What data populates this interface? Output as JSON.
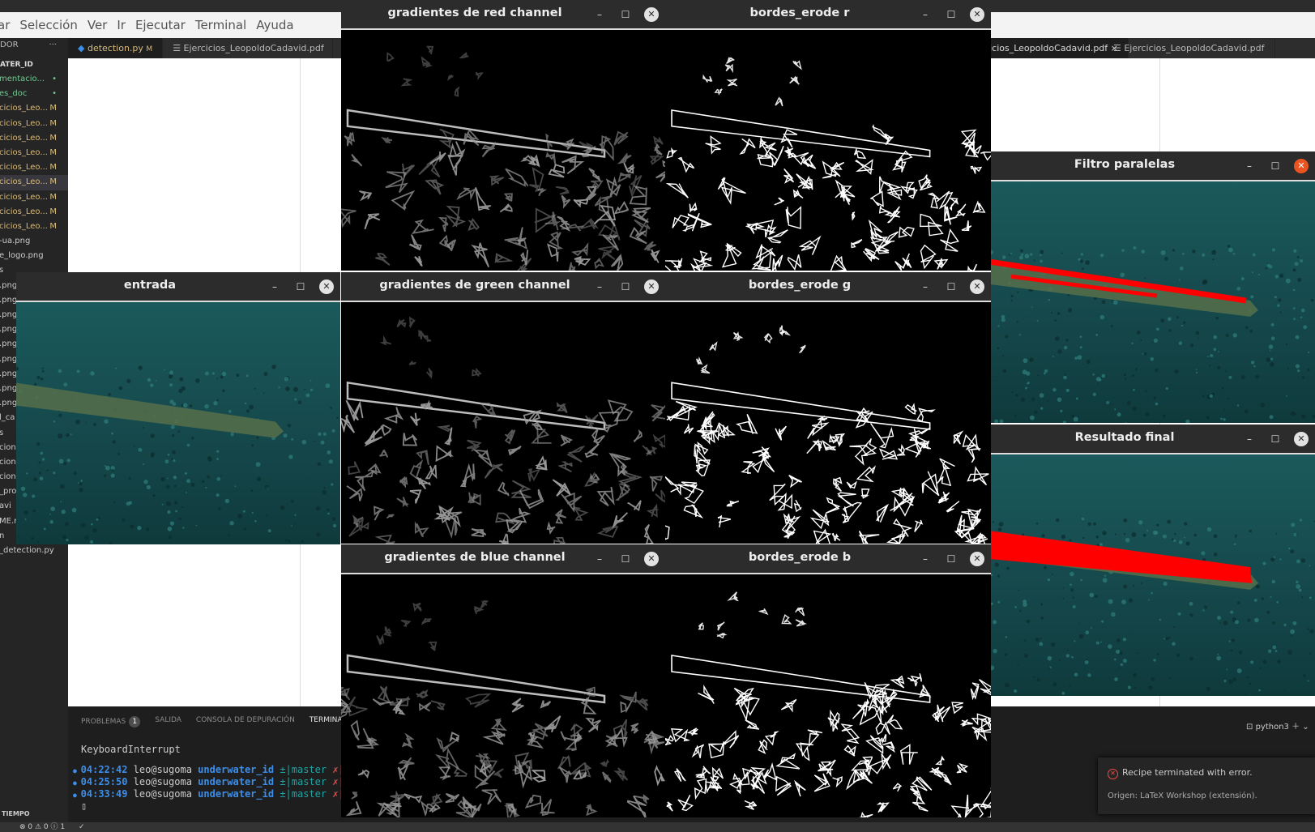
{
  "menubar": {
    "items": [
      "ar",
      "Selección",
      "Ver",
      "Ir",
      "Ejecutar",
      "Terminal",
      "Ayuda"
    ]
  },
  "sidebar": {
    "header": "DOR",
    "more": "···",
    "root": "ATER_ID",
    "files": [
      {
        "name": "mentacio...",
        "badge": "•",
        "style": "folder"
      },
      {
        "name": "es_doc",
        "badge": "•",
        "style": "folder"
      },
      {
        "name": "cicios_Leo...",
        "badge": "M",
        "style": "modified"
      },
      {
        "name": "cicios_Leo...",
        "badge": "M",
        "style": "modified"
      },
      {
        "name": "cicios_Leo...",
        "badge": "M",
        "style": "modified"
      },
      {
        "name": "cicios_Leo...",
        "badge": "M",
        "style": "modified"
      },
      {
        "name": "cicios_Leo...",
        "badge": "M",
        "style": "modified"
      },
      {
        "name": "cicios_Leo...",
        "badge": "M",
        "style": "selected"
      },
      {
        "name": "cicios_Leo...",
        "badge": "M",
        "style": "modified"
      },
      {
        "name": "cicios_Leo...",
        "badge": "M",
        "style": "modified"
      },
      {
        "name": "cicios_Leo...",
        "badge": "M",
        "style": "modified"
      },
      {
        "name": "-ua.png",
        "badge": "",
        "style": "plain"
      },
      {
        "name": "e_logo.png",
        "badge": "",
        "style": "plain"
      },
      {
        "name": "s",
        "badge": "",
        "style": "plain"
      },
      {
        "name": ".png",
        "badge": "",
        "style": "plain"
      },
      {
        "name": ".png",
        "badge": "",
        "style": "plain"
      },
      {
        "name": ".png",
        "badge": "",
        "style": "plain"
      },
      {
        "name": ".png",
        "badge": "",
        "style": "plain"
      },
      {
        "name": ".png",
        "badge": "",
        "style": "plain"
      },
      {
        "name": ".png",
        "badge": "",
        "style": "plain"
      },
      {
        "name": ".png",
        "badge": "",
        "style": "plain"
      },
      {
        "name": ".png",
        "badge": "",
        "style": "plain"
      },
      {
        "name": ".png",
        "badge": "",
        "style": "plain"
      },
      {
        "name": "l_ca",
        "badge": "",
        "style": "plain"
      },
      {
        "name": "s",
        "badge": "",
        "style": "plain"
      },
      {
        "name": "cion",
        "badge": "",
        "style": "plain"
      },
      {
        "name": "cion.",
        "badge": "",
        "style": "plain"
      },
      {
        "name": "cion",
        "badge": "",
        "style": "plain"
      },
      {
        "name": "_pro",
        "badge": "",
        "style": "plain"
      },
      {
        "name": "avi",
        "badge": "",
        "style": "plain"
      },
      {
        "name": "ME.r",
        "badge": "",
        "style": "plain"
      },
      {
        "name": "n",
        "badge": "",
        "style": "plain"
      },
      {
        "name": "_detection.py",
        "badge": "",
        "style": "plain"
      }
    ],
    "timeline": "TIEMPO"
  },
  "tabs": [
    {
      "label": "detection.py",
      "badge": "M",
      "icon": "python-file-icon",
      "active": true
    },
    {
      "label": "Ejercicios_LeopoldoCadavid.pdf",
      "badge": "",
      "icon": "pdf-file-icon",
      "active": false
    },
    {
      "label": "Ejercicios_LeopoldoCadavid.pdf",
      "badge": "×",
      "icon": "pdf-file-icon",
      "active": true
    },
    {
      "label": "Ejercicios_LeopoldoCadavid.pdf",
      "badge": "",
      "icon": "pdf-file-icon",
      "active": false
    }
  ],
  "panel": {
    "tabs": [
      "PROBLEMAS",
      "SALIDA",
      "CONSOLA DE DEPURACIÓN",
      "TERMINA"
    ],
    "problems_count": "1",
    "shell": "python3",
    "terminal": {
      "interrupt": "KeyboardInterrupt",
      "lines": [
        {
          "time": "04:22:42",
          "user": "leo@sugoma",
          "dir": "underwater_id",
          "branch": "±|master",
          "flag": "✗|"
        },
        {
          "time": "04:25:50",
          "user": "leo@sugoma",
          "dir": "underwater_id",
          "branch": "±|master",
          "flag": "✗|"
        },
        {
          "time": "04:33:49",
          "user": "leo@sugoma",
          "dir": "underwater_id",
          "branch": "±|master",
          "flag": "✗|"
        }
      ]
    }
  },
  "notification": {
    "message": "Recipe terminated with error.",
    "source": "Origen: LaTeX Workshop (extensión)."
  },
  "statusbar": {
    "errors": "⊗ 0 ⚠ 0 ⓘ 1",
    "check": "✓"
  },
  "windows": [
    {
      "id": "grad-r",
      "title": "gradientes de red channel",
      "kind": "gradient"
    },
    {
      "id": "bordes-r",
      "title": "bordes_erode r",
      "kind": "edges"
    },
    {
      "id": "filtro",
      "title": "Filtro paralelas",
      "kind": "underwater-lines"
    },
    {
      "id": "entrada",
      "title": "entrada",
      "kind": "underwater"
    },
    {
      "id": "grad-g",
      "title": "gradientes de green channel",
      "kind": "gradient"
    },
    {
      "id": "bordes-g",
      "title": "bordes_erode g",
      "kind": "edges"
    },
    {
      "id": "resultado",
      "title": "Resultado final",
      "kind": "underwater-fill"
    },
    {
      "id": "grad-b",
      "title": "gradientes de blue channel",
      "kind": "gradient"
    },
    {
      "id": "bordes-b",
      "title": "bordes_erode b",
      "kind": "edges"
    }
  ],
  "window_buttons": {
    "minimize": "–",
    "maximize": "☐",
    "close": "✕"
  },
  "colors": {
    "detection_red": "#ff0000",
    "water": "#1f5a5e",
    "pipe": "#5e7a4a",
    "close_active": "#e95420"
  }
}
